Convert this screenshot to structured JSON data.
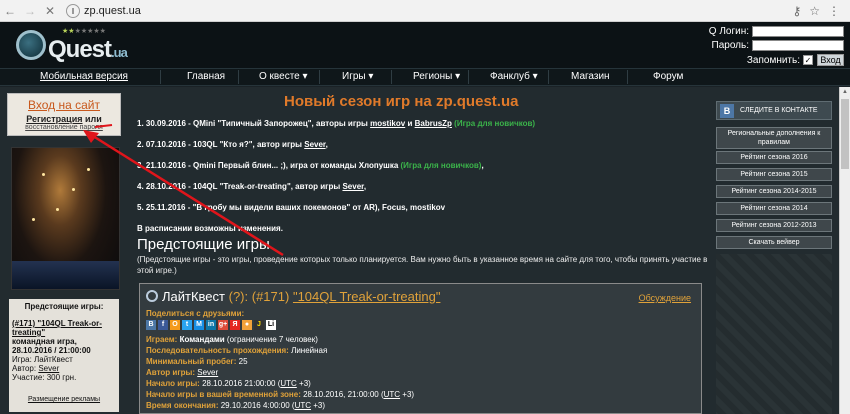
{
  "browser": {
    "url": "zp.quest.ua"
  },
  "header": {
    "logo_text": "Quest",
    "logo_suffix": ".ua",
    "login_label": "Q Логин:",
    "password_label": "Пароль:",
    "remember_label": "Запомнить:",
    "remember_checked": "✓",
    "enter_button": "Вход"
  },
  "menu": {
    "mobile": "Мобильная версия",
    "items": [
      "Главная",
      "О квесте ▾",
      "Игры ▾",
      "Регионы ▾",
      "Фанклуб ▾",
      "Магазин",
      "Форум"
    ]
  },
  "left": {
    "login_link": "Вход на сайт",
    "register": "Регистрация",
    "or": " или",
    "restore": "восстановление пароля",
    "upcoming_title": "Предстоящие игры:",
    "game_link": "(#171) \"104QL Treak-or-treating\"",
    "game_type": "командная игра,",
    "game_date": "28.10.2016 / 21:00:00",
    "game_kind": "Игра: ЛайтКвест",
    "author_label": "Автор: ",
    "author": "Sever",
    "fee": "Участие: 300 грн.",
    "ads": "Размещение рекламы"
  },
  "main": {
    "title": "Новый сезон игр на zp.quest.ua",
    "news": [
      {
        "prefix": "1. 30.09.2016 - QMini \"Типичный Запорожец\", авторы игры ",
        "a1": "mostikov",
        "mid": " и ",
        "a2": "BabrusZp",
        "tag": " (Игра для новичков)"
      },
      {
        "prefix": "2. 07.10.2016 - 103QL \"Кто я?\", автор игры ",
        "a1": "Sever",
        "tail": ","
      },
      {
        "prefix": "3. 21.10.2016 - Qmini Первый блин... ;), игра от команды Хлопушка",
        "tag": " (Игра для новичков)",
        "tail": ","
      },
      {
        "prefix": "4. 28.10.2016 - 104QL \"Treak-or-treating\", автор игры ",
        "a1": "Sever",
        "tail": ","
      },
      {
        "prefix": "5. 25.11.2016 - \"В гробу мы видели ваших покемонов\" от AR), Focus, mostikov"
      },
      {
        "prefix": "В расписании возможны изменения."
      }
    ],
    "section_title": "Предстоящие игры",
    "section_desc": "(Предстоящие игры - это игры, проведение которых только планируется. Вам нужно быть в указанное время на сайте для того, чтобы принять участие в этой игре.)"
  },
  "game": {
    "name": "ЛайтКвест",
    "q": "(?):",
    "num": "(#171)",
    "link": "\"104QL Treak-or-treating\"",
    "discussion": "Обсуждение",
    "share": "Поделиться с друзьями:",
    "social": [
      "В",
      "f",
      "О",
      "t",
      "М",
      "in",
      "g+",
      "Я",
      "●",
      "J",
      "Li"
    ],
    "lines": [
      {
        "k": "Играем: ",
        "v": "Командами",
        "n": " (ограничение 7 человек)"
      },
      {
        "k": "Последовательность прохождения: ",
        "v": "Линейная"
      },
      {
        "k": "Минимальный пробег: ",
        "v": "25"
      },
      {
        "k": "Автор игры: ",
        "u": "Sever"
      },
      {
        "k": "Начало игры: ",
        "v": "28.10.2016 21:00:00 (",
        "u": "UTC",
        "t": " +3)"
      },
      {
        "k": "Начало игры в вашей временной зоне: ",
        "v": "28.10.2016, 21:00:00 (",
        "u": "UTC",
        "t": " +3)"
      },
      {
        "k": "Время окончания: ",
        "v": "29.10.2016 4:00:00 (",
        "u": "UTC",
        "t": " +3)"
      }
    ]
  },
  "right": {
    "vk_logo": "В",
    "vk": "СЛЕДИТЕ В КОНТАКТЕ",
    "buttons": [
      "Региональные дополнения к правилам",
      "Рейтинг сезона 2016",
      "Рейтинг сезона 2015",
      "Рейтинг сезона 2014-2015",
      "Рейтинг сезона 2014",
      "Рейтинг сезона 2012-2013",
      "Скачать вейвер"
    ]
  }
}
